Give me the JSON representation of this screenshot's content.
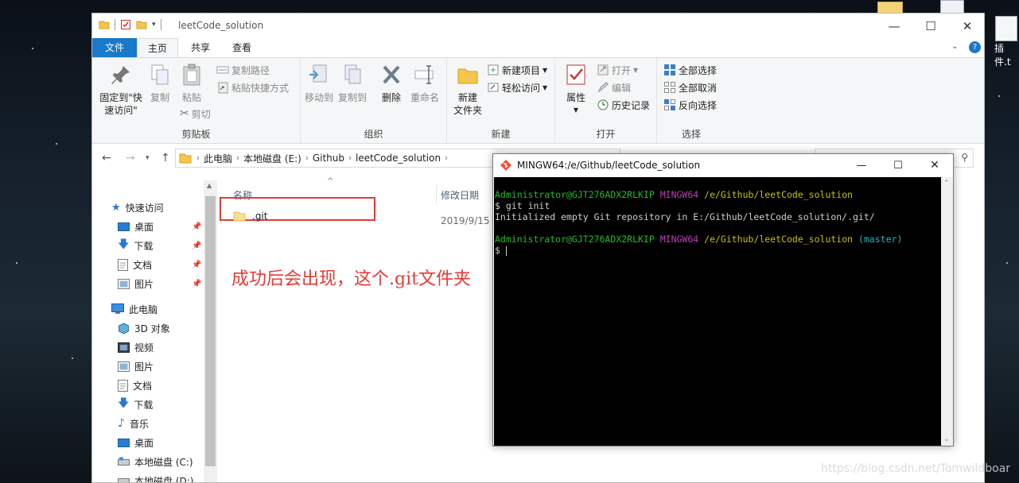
{
  "desktop": {
    "right_icon_label": "插件.t"
  },
  "explorer": {
    "title": "leetCode_solution",
    "tabs": [
      {
        "label": "文件"
      },
      {
        "label": "主页"
      },
      {
        "label": "共享"
      },
      {
        "label": "查看"
      }
    ],
    "ribbon": {
      "clipboard": {
        "label": "剪贴板",
        "pin": "固定到\"快",
        "pin2": "速访问\"",
        "copy": "复制",
        "paste": "粘贴",
        "copy_path": "复制路径",
        "paste_shortcut": "粘贴快捷方式",
        "cut": "剪切"
      },
      "organize": {
        "label": "组织",
        "move_to": "移动到",
        "copy_to": "复制到",
        "delete": "删除",
        "rename": "重命名"
      },
      "new": {
        "label": "新建",
        "new_folder_1": "新建",
        "new_folder_2": "文件夹",
        "new_item": "新建项目",
        "easy_access": "轻松访问"
      },
      "open": {
        "label": "打开",
        "properties": "属性",
        "open": "打开",
        "edit": "编辑",
        "history": "历史记录"
      },
      "select": {
        "label": "选择",
        "select_all": "全部选择",
        "select_none": "全部取消",
        "invert": "反向选择"
      }
    },
    "breadcrumbs": [
      "此电脑",
      "本地磁盘 (E:)",
      "Github",
      "leetCode_solution"
    ],
    "nav": {
      "quick_access": "快速访问",
      "qa_items": [
        "桌面",
        "下载",
        "文档",
        "图片"
      ],
      "this_pc": "此电脑",
      "pc_items": [
        "3D 对象",
        "视频",
        "图片",
        "文档",
        "下载",
        "音乐",
        "桌面",
        "本地磁盘 (C:)",
        "本地磁盘 (D:)"
      ]
    },
    "columns": {
      "name": "名称",
      "date": "修改日期"
    },
    "files": [
      {
        "name": ".git",
        "date": "2019/9/15"
      }
    ],
    "annotation": "成功后会出现，这个.git文件夹"
  },
  "terminal": {
    "title": "MINGW64:/e/Github/leetCode_solution",
    "user": "Administrator@GJT276ADX2RLKIP",
    "shell": "MINGW64",
    "path": "/e/Github/leetCode_solution",
    "branch": "(master)",
    "prompt": "$",
    "command": "git init",
    "output": "Initialized empty Git repository in E:/Github/leetCode_solution/.git/"
  },
  "watermark": "https://blog.csdn.net/Tomwildboar",
  "colors": {
    "accent": "#1979ca",
    "highlight": "#e53935",
    "term_green": "#25bc24",
    "term_magenta": "#bc3fbc",
    "term_yellow": "#c7c400",
    "term_cyan": "#2bb3c5"
  }
}
